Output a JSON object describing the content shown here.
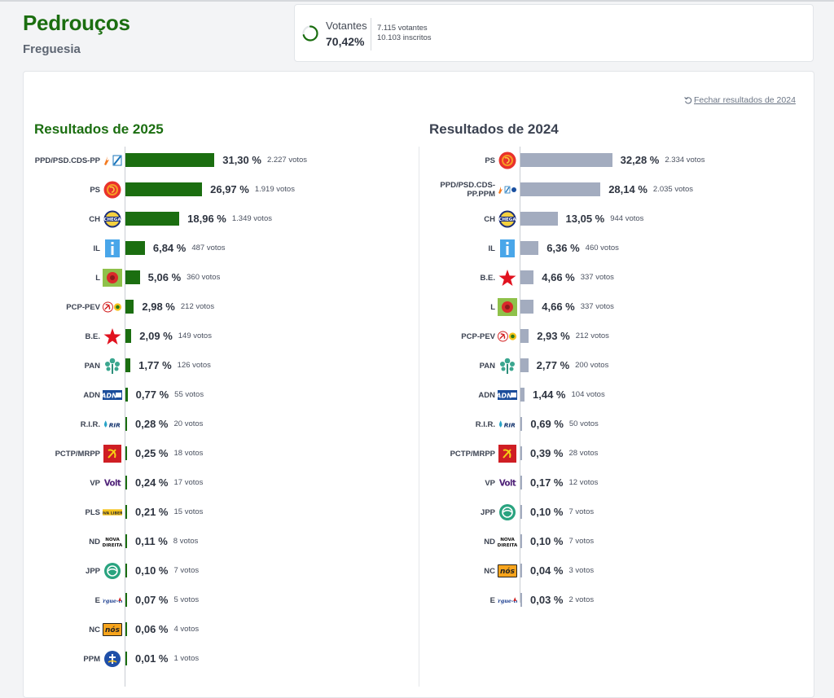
{
  "header": {
    "title": "Pedrouços",
    "subtitle": "Freguesia"
  },
  "turnout": {
    "label": "Votantes",
    "percent_label": "70,42%",
    "percent_value": 70.42,
    "voters": "7.115 votantes",
    "registered": "10.103 inscritos"
  },
  "close_link": "Fechar resultados de 2024",
  "colors": {
    "bar_2025": "#1b6e10",
    "bar_2024": "#a3acbf",
    "accent": "#1b6e10"
  },
  "results_2025": {
    "title": "Resultados de 2025",
    "rows": [
      {
        "party": "PPD/PSD.CDS-PP",
        "logo": "psd-cds-icon",
        "pct_value": 31.3,
        "pct": "31,30 %",
        "votes": "2.227 votos"
      },
      {
        "party": "PS",
        "logo": "ps-icon",
        "pct_value": 26.97,
        "pct": "26,97 %",
        "votes": "1.919 votos"
      },
      {
        "party": "CH",
        "logo": "chega-icon",
        "pct_value": 18.96,
        "pct": "18,96 %",
        "votes": "1.349 votos"
      },
      {
        "party": "IL",
        "logo": "il-icon",
        "pct_value": 6.84,
        "pct": "6,84 %",
        "votes": "487 votos"
      },
      {
        "party": "L",
        "logo": "livre-icon",
        "pct_value": 5.06,
        "pct": "5,06 %",
        "votes": "360 votos"
      },
      {
        "party": "PCP-PEV",
        "logo": "pcp-pev-icon",
        "pct_value": 2.98,
        "pct": "2,98 %",
        "votes": "212 votos"
      },
      {
        "party": "B.E.",
        "logo": "be-star-icon",
        "pct_value": 2.09,
        "pct": "2,09 %",
        "votes": "149 votos"
      },
      {
        "party": "PAN",
        "logo": "pan-tree-icon",
        "pct_value": 1.77,
        "pct": "1,77 %",
        "votes": "126 votos"
      },
      {
        "party": "ADN",
        "logo": "adn-icon",
        "pct_value": 0.77,
        "pct": "0,77 %",
        "votes": "55 votos"
      },
      {
        "party": "R.I.R.",
        "logo": "rir-icon",
        "pct_value": 0.28,
        "pct": "0,28 %",
        "votes": "20 votos"
      },
      {
        "party": "PCTP/MRPP",
        "logo": "pctp-icon",
        "pct_value": 0.25,
        "pct": "0,25 %",
        "votes": "18 votos"
      },
      {
        "party": "VP",
        "logo": "volt-icon",
        "pct_value": 0.24,
        "pct": "0,24 %",
        "votes": "17 votos"
      },
      {
        "party": "PLS",
        "logo": "pls-icon",
        "pct_value": 0.21,
        "pct": "0,21 %",
        "votes": "15 votos"
      },
      {
        "party": "ND",
        "logo": "nova-direita-icon",
        "pct_value": 0.11,
        "pct": "0,11 %",
        "votes": "8 votos"
      },
      {
        "party": "JPP",
        "logo": "jpp-icon",
        "pct_value": 0.1,
        "pct": "0,10 %",
        "votes": "7 votos"
      },
      {
        "party": "E",
        "logo": "ergue-te-icon",
        "pct_value": 0.07,
        "pct": "0,07 %",
        "votes": "5 votos"
      },
      {
        "party": "NC",
        "logo": "nos-cidadaos-icon",
        "pct_value": 0.06,
        "pct": "0,06 %",
        "votes": "4 votos"
      },
      {
        "party": "PPM",
        "logo": "ppm-icon",
        "pct_value": 0.01,
        "pct": "0,01 %",
        "votes": "1 votos"
      }
    ]
  },
  "results_2024": {
    "title": "Resultados de 2024",
    "rows": [
      {
        "party": "PS",
        "logo": "ps-icon",
        "pct_value": 32.28,
        "pct": "32,28 %",
        "votes": "2.334 votos"
      },
      {
        "party": "PPD/PSD.CDS-PP.PPM",
        "party_lines": [
          "PPD/PSD.CDS-",
          "PP.PPM"
        ],
        "logo": "psd-cds-ppm-icon",
        "pct_value": 28.14,
        "pct": "28,14 %",
        "votes": "2.035 votos"
      },
      {
        "party": "CH",
        "logo": "chega-icon",
        "pct_value": 13.05,
        "pct": "13,05 %",
        "votes": "944 votos"
      },
      {
        "party": "IL",
        "logo": "il-icon",
        "pct_value": 6.36,
        "pct": "6,36 %",
        "votes": "460 votos"
      },
      {
        "party": "B.E.",
        "logo": "be-star-icon",
        "pct_value": 4.66,
        "pct": "4,66 %",
        "votes": "337 votos"
      },
      {
        "party": "L",
        "logo": "livre-icon",
        "pct_value": 4.66,
        "pct": "4,66 %",
        "votes": "337 votos"
      },
      {
        "party": "PCP-PEV",
        "logo": "pcp-pev-icon",
        "pct_value": 2.93,
        "pct": "2,93 %",
        "votes": "212 votos"
      },
      {
        "party": "PAN",
        "logo": "pan-tree-icon",
        "pct_value": 2.77,
        "pct": "2,77 %",
        "votes": "200 votos"
      },
      {
        "party": "ADN",
        "logo": "adn-icon",
        "pct_value": 1.44,
        "pct": "1,44 %",
        "votes": "104 votos"
      },
      {
        "party": "R.I.R.",
        "logo": "rir-icon",
        "pct_value": 0.69,
        "pct": "0,69 %",
        "votes": "50 votos"
      },
      {
        "party": "PCTP/MRPP",
        "logo": "pctp-icon",
        "pct_value": 0.39,
        "pct": "0,39 %",
        "votes": "28 votos"
      },
      {
        "party": "VP",
        "logo": "volt-icon",
        "pct_value": 0.17,
        "pct": "0,17 %",
        "votes": "12 votos"
      },
      {
        "party": "JPP",
        "logo": "jpp-icon",
        "pct_value": 0.1,
        "pct": "0,10 %",
        "votes": "7 votos"
      },
      {
        "party": "ND",
        "logo": "nova-direita-icon",
        "pct_value": 0.1,
        "pct": "0,10 %",
        "votes": "7 votos"
      },
      {
        "party": "NC",
        "logo": "nos-cidadaos-icon",
        "pct_value": 0.04,
        "pct": "0,04 %",
        "votes": "3 votos"
      },
      {
        "party": "E",
        "logo": "ergue-te-icon",
        "pct_value": 0.03,
        "pct": "0,03 %",
        "votes": "2 votos"
      }
    ]
  }
}
